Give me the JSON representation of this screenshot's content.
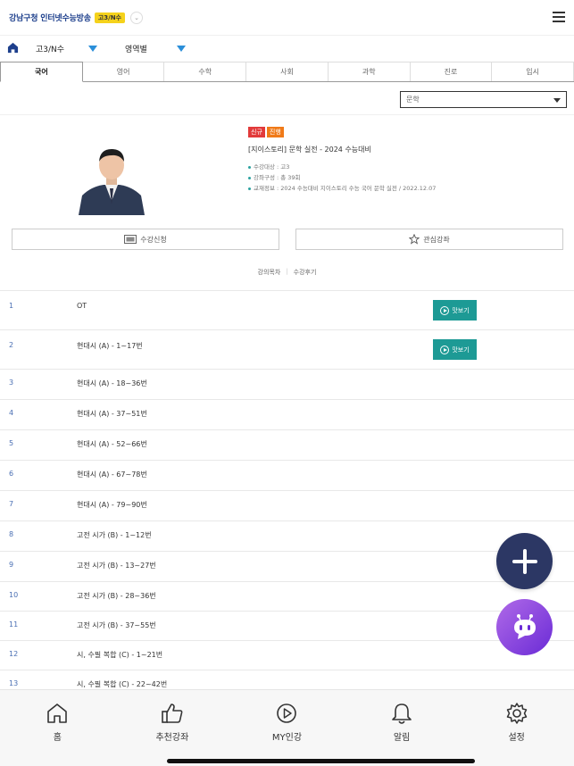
{
  "header": {
    "brand": "강남구청 인터넷수능방송",
    "grade_badge": "고3/N수"
  },
  "filters": {
    "grade": "고3/N수",
    "category": "영역별"
  },
  "tabs": [
    {
      "label": "국어",
      "active": true
    },
    {
      "label": "영어",
      "active": false
    },
    {
      "label": "수학",
      "active": false
    },
    {
      "label": "사회",
      "active": false
    },
    {
      "label": "과학",
      "active": false
    },
    {
      "label": "진로",
      "active": false
    },
    {
      "label": "입시",
      "active": false
    }
  ],
  "select": {
    "value": "문학"
  },
  "course": {
    "badges": [
      "신규",
      "진행"
    ],
    "title": "[지이스토리] 문학 실전 - 2024 수능대비",
    "meta": [
      "수강대상 : 고3",
      "강좌구성 : 총 39회",
      "교재정보 : 2024 수능대비 지이스토리 수능 국어 문학 실전 / 2022.12.07"
    ]
  },
  "actions": {
    "enroll": "수강신청",
    "favorite": "관심강좌"
  },
  "subtabs": {
    "list": "강의목차",
    "review": "수강후기"
  },
  "preview_label": "맛보기",
  "lectures": [
    {
      "num": "1",
      "title": "OT",
      "preview": true
    },
    {
      "num": "2",
      "title": "현대시 (A) - 1~17번",
      "preview": true
    },
    {
      "num": "3",
      "title": "현대시 (A) - 18~36번",
      "preview": false
    },
    {
      "num": "4",
      "title": "현대시 (A) - 37~51번",
      "preview": false
    },
    {
      "num": "5",
      "title": "현대시 (A) - 52~66번",
      "preview": false
    },
    {
      "num": "6",
      "title": "현대시 (A) - 67~78번",
      "preview": false
    },
    {
      "num": "7",
      "title": "현대시 (A) - 79~90번",
      "preview": false
    },
    {
      "num": "8",
      "title": "고전 시가 (B) - 1~12번",
      "preview": false
    },
    {
      "num": "9",
      "title": "고전 시가 (B) - 13~27번",
      "preview": false
    },
    {
      "num": "10",
      "title": "고전 시가 (B) - 28~36번",
      "preview": false
    },
    {
      "num": "11",
      "title": "고전 시가 (B) - 37~55번",
      "preview": false
    },
    {
      "num": "12",
      "title": "시, 수필 복합 (C) - 1~21번",
      "preview": false
    },
    {
      "num": "13",
      "title": "시, 수필 복합 (C) - 22~42번",
      "preview": false
    }
  ],
  "bottom_nav": [
    {
      "label": "홈",
      "icon": "home-icon"
    },
    {
      "label": "추천강좌",
      "icon": "thumbs-up-icon"
    },
    {
      "label": "MY인강",
      "icon": "play-circle-icon"
    },
    {
      "label": "알림",
      "icon": "bell-icon"
    },
    {
      "label": "설정",
      "icon": "gear-icon"
    }
  ],
  "colors": {
    "brand": "#1d3f8c",
    "accent": "#1d9a95",
    "filter_arrow": "#2b8fd9",
    "fab": "#2c3764"
  }
}
